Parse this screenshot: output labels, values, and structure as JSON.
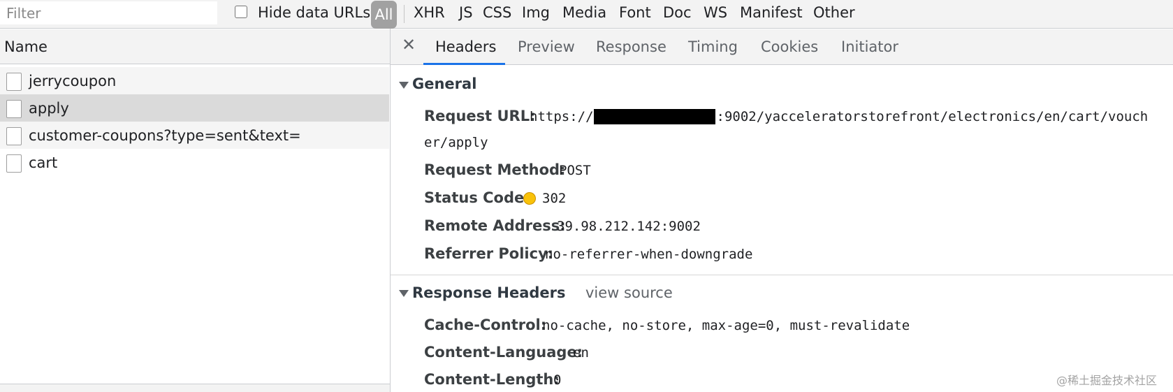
{
  "toolbar": {
    "filter_placeholder": "Filter",
    "hide_data_urls_label": "Hide data URLs",
    "hide_data_urls_checked": false,
    "type_filters": [
      "All",
      "XHR",
      "JS",
      "CSS",
      "Img",
      "Media",
      "Font",
      "Doc",
      "WS",
      "Manifest",
      "Other"
    ],
    "active_type": "All"
  },
  "request_list": {
    "column_header": "Name",
    "requests": [
      {
        "name": "jerrycoupon"
      },
      {
        "name": "apply",
        "selected": true
      },
      {
        "name": "customer-coupons?type=sent&text="
      },
      {
        "name": "cart"
      }
    ]
  },
  "details": {
    "tabs": [
      "Headers",
      "Preview",
      "Response",
      "Timing",
      "Cookies",
      "Initiator"
    ],
    "active_tab": "Headers",
    "general": {
      "title": "General",
      "request_url_label": "Request URL:",
      "request_url_prefix": "https://",
      "request_url_suffix": ":9002/yacceleratorstorefront/electronics/en/cart/vouch",
      "request_url_wrap": "er/apply",
      "request_method_label": "Request Method:",
      "request_method": "POST",
      "status_code_label": "Status Code:",
      "status_code": "302",
      "status_color": "#f9c20a",
      "remote_address_label": "Remote Address:",
      "remote_address": "39.98.212.142:9002",
      "referrer_policy_label": "Referrer Policy:",
      "referrer_policy": "no-referrer-when-downgrade"
    },
    "response_headers": {
      "title": "Response Headers",
      "view_source": "view source",
      "cache_control_label": "Cache-Control:",
      "cache_control": "no-cache, no-store, max-age=0, must-revalidate",
      "content_language_label": "Content-Language:",
      "content_language": "en",
      "content_length_label": "Content-Length:",
      "content_length": "0"
    }
  },
  "watermark": "@稀土掘金技术社区",
  "colors": {
    "accent": "#1a73e8",
    "selected_row": "#dadada",
    "toolbar_bg": "#f3f3f3"
  }
}
